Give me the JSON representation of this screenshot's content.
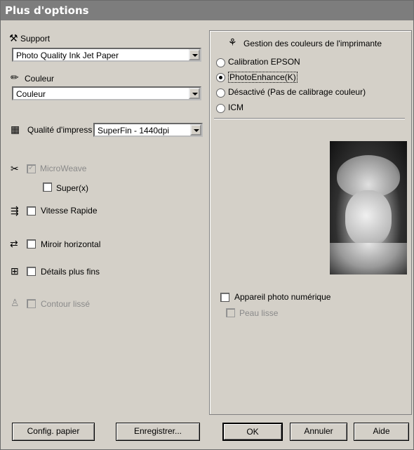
{
  "window": {
    "title": "Plus d'options"
  },
  "left": {
    "support_label": "Support",
    "support_value": "Photo Quality Ink Jet Paper",
    "couleur_label": "Couleur",
    "couleur_value": "Couleur",
    "qualite_label": "Qualité d'impress",
    "qualite_value": "SuperFin - 1440dpi",
    "microweave_label": "MicroWeave",
    "super_label": "Super(x)",
    "vitesse_label": "Vitesse Rapide",
    "miroir_label": "Miroir horizontal",
    "details_label": "Détails plus fins",
    "contour_label": "Contour lissé"
  },
  "right": {
    "group_title": "Gestion des couleurs de l'imprimante",
    "radio_calibration": "Calibration EPSON",
    "radio_photoenhance": "PhotoEnhance(K)",
    "radio_desactive": "Désactivé (Pas de calibrage couleur)",
    "radio_icm": "ICM",
    "appareil_label": "Appareil photo numérique",
    "peau_label": "Peau lisse"
  },
  "buttons": {
    "config": "Config. papier",
    "enregistrer": "Enregistrer...",
    "ok": "OK",
    "annuler": "Annuler",
    "aide": "Aide"
  },
  "icons": {
    "support": "paper-tool-icon",
    "couleur": "color-tool-icon",
    "qualite": "quality-icon",
    "microweave": "microweave-icon",
    "vitesse": "speed-icon",
    "miroir": "mirror-icon",
    "details": "detail-icon",
    "contour": "contour-icon",
    "gestion": "color-management-icon"
  }
}
